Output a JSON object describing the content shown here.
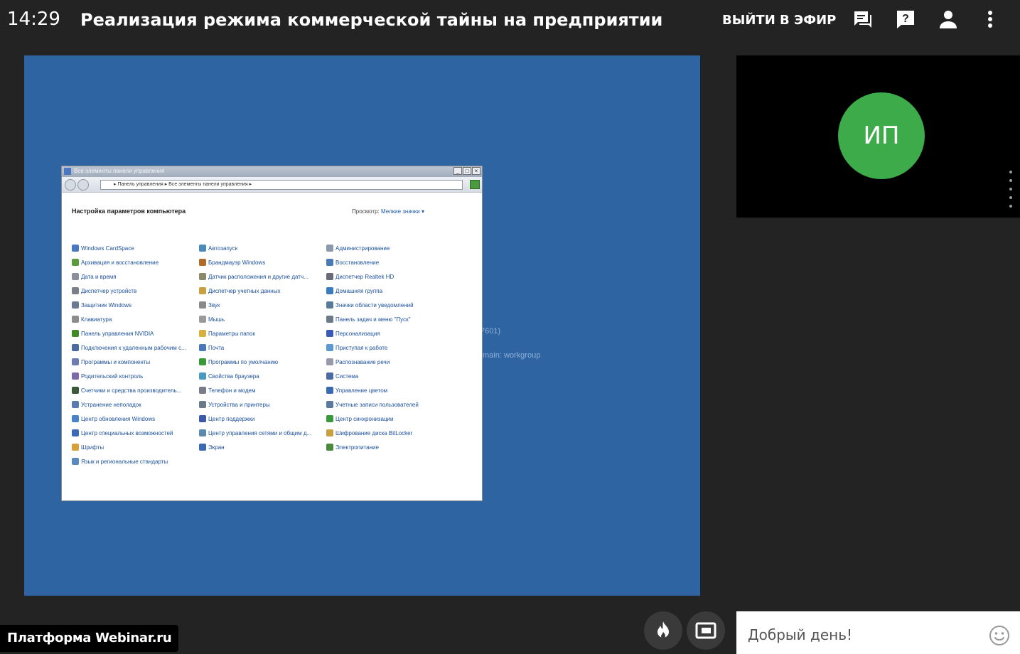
{
  "header": {
    "time": "14:29",
    "title": "Реализация режима коммерческой тайны на предприятии",
    "go_live_label": "ВЫЙТИ В ЭФИР",
    "icons": [
      "chat-icon",
      "help-icon",
      "person-icon",
      "more-vert-icon"
    ]
  },
  "screen_share": {
    "background_color": "#2f64a3",
    "bg_fragments": [
      "7601)",
      "main: workgroup"
    ],
    "window": {
      "title": "Все элементы панели управления",
      "address": "▸ Панель управления ▸ Все элементы панели управления ▸",
      "heading": "Настройка параметров компьютера",
      "view_label": "Просмотр:",
      "view_value": "Мелкие значки ▾",
      "columns": [
        [
          "Windows CardSpace",
          "Архивация и восстановление",
          "Дата и время",
          "Диспетчер устройств",
          "Защитник Windows",
          "Клавиатура",
          "Панель управления NVIDIA",
          "Подключения к удаленным рабочим с...",
          "Программы и компоненты",
          "Родительский контроль",
          "Счетчики и средства производитель...",
          "Устранение неполадок",
          "Центр обновления Windows",
          "Центр специальных возможностей",
          "Шрифты",
          "Язык и региональные стандарты"
        ],
        [
          "Автозапуск",
          "Брандмауэр Windows",
          "Датчик расположения и другие датч...",
          "Диспетчер учетных данных",
          "Звук",
          "Мышь",
          "Параметры папок",
          "Почта",
          "Программы по умолчанию",
          "Свойства браузера",
          "Телефон и модем",
          "Устройства и принтеры",
          "Центр поддержки",
          "Центр управления сетями и общим д...",
          "Экран"
        ],
        [
          "Администрирование",
          "Восстановление",
          "Диспетчер Realtek HD",
          "Домашняя группа",
          "Значки области уведомлений",
          "Панель задач и меню \"Пуск\"",
          "Персонализация",
          "Приступая к работе",
          "Распознавание речи",
          "Система",
          "Управление цветом",
          "Учетные записи пользователей",
          "Центр синхронизации",
          "Шифрование диска BitLocker",
          "Электропитание"
        ]
      ]
    }
  },
  "participant": {
    "initials": "ИП",
    "avatar_color": "#3eab4b"
  },
  "footer": {
    "platform_label": "Платформа Webinar.ru",
    "buttons": [
      "fire-icon",
      "picture-in-picture-icon"
    ]
  },
  "chat": {
    "input_text": "Добрый день!"
  }
}
